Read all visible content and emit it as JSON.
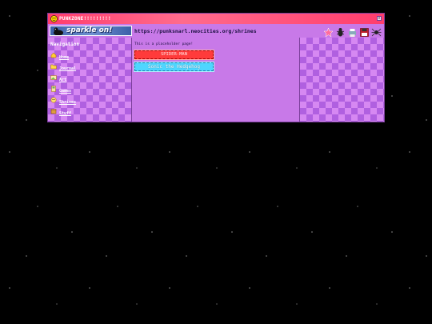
{
  "window": {
    "title": "PUNKZONE!!!!!!!!!"
  },
  "banner": {
    "text": "sparkle on!"
  },
  "address": {
    "url": "https://punksnarl.neocities.org/shrines"
  },
  "toolbar_icons": [
    "star-icon",
    "bug-icon",
    "printer-icon",
    "disk-icon",
    "spider-icon"
  ],
  "navigation": {
    "heading": "Navigation",
    "items": [
      {
        "label": "Home",
        "icon": "house-icon"
      },
      {
        "label": "Journal",
        "icon": "folder-icon"
      },
      {
        "label": "Art",
        "icon": "picture-icon"
      },
      {
        "label": "Games",
        "icon": "game-icon"
      },
      {
        "label": "Shrines",
        "icon": "shrine-icon"
      },
      {
        "label": "Stuff",
        "icon": "box-icon"
      }
    ]
  },
  "content": {
    "placeholder_text": "This is a placeholder page!",
    "shrine_buttons": [
      "SPIDER-MAN",
      "Sonic the Hedgehog"
    ]
  },
  "colors": {
    "titlebar": "#ff3d6d",
    "panel": "#c879e8",
    "checker": "#b060e0",
    "spiderman_button": "#ff3b3b",
    "sonic_button": "#4fd6ff"
  }
}
